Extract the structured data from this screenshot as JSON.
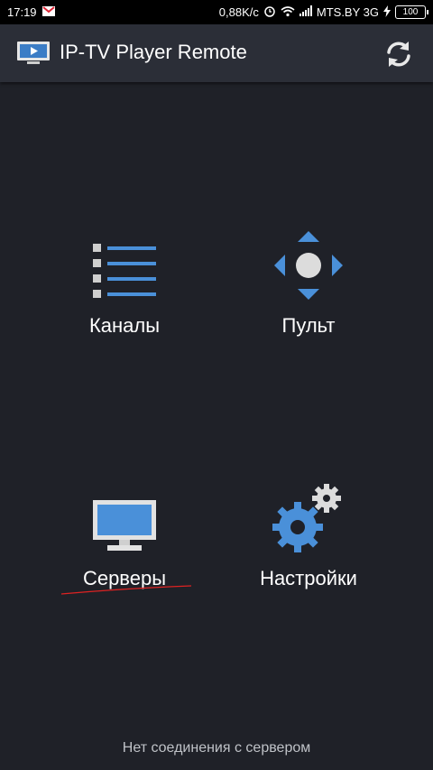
{
  "status_bar": {
    "time": "17:19",
    "speed": "0,88K/c",
    "carrier": "MTS.BY 3G",
    "battery": "100",
    "icons": [
      "gmail-icon",
      "alarm-icon",
      "wifi-icon",
      "signal-icon",
      "charging-icon",
      "battery-icon"
    ]
  },
  "app_bar": {
    "title": "IP-TV Player Remote",
    "logo_icon": "tv-play-icon",
    "refresh_icon": "refresh-icon"
  },
  "menu": {
    "items": [
      {
        "label": "Каналы",
        "icon": "list-icon"
      },
      {
        "label": "Пульт",
        "icon": "dpad-icon"
      },
      {
        "label": "Серверы",
        "icon": "monitor-icon"
      },
      {
        "label": "Настройки",
        "icon": "gears-icon"
      }
    ]
  },
  "footer": {
    "status": "Нет соединения с сервером"
  },
  "colors": {
    "background": "#1f2128",
    "app_bar": "#2b2e37",
    "accent_blue": "#4a90d9",
    "icon_gray": "#dcdcdc"
  }
}
